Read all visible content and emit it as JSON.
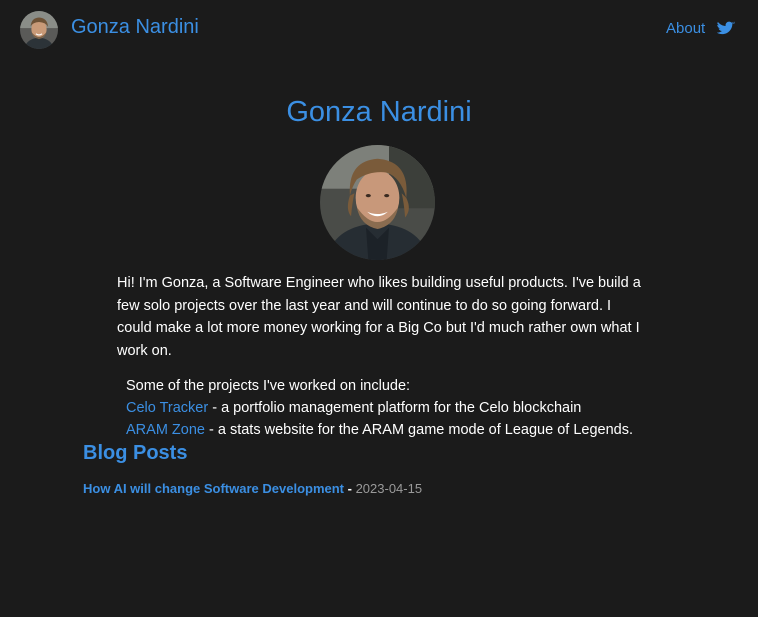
{
  "header": {
    "site_name": "Gonza Nardini",
    "nav_about": "About",
    "twitter_icon": "twitter-bird-icon"
  },
  "colors": {
    "background": "#1b1b1b",
    "accent": "#3b8fe3",
    "text": "#ffffff",
    "muted": "#9a9a9a"
  },
  "hero": {
    "title": "Gonza Nardini",
    "avatar_icon": "profile-photo"
  },
  "intro": "Hi! I'm Gonza, a Software Engineer who likes building useful products. I've build a few solo projects over the last year and will continue to do so going forward. I could make a lot more money working for a Big Co but I'd much rather own what I work on.",
  "projects": {
    "heading": "Some of the projects I've worked on include:",
    "items": [
      {
        "name": "Celo Tracker",
        "description": " - a portfolio management platform for the Celo blockchain"
      },
      {
        "name": "ARAM Zone",
        "description": " - a stats website for the ARAM game mode of League of Legends."
      }
    ]
  },
  "blog": {
    "heading": "Blog Posts",
    "posts": [
      {
        "title": "How AI will change Software Development",
        "separator": " - ",
        "date": "2023-04-15"
      }
    ]
  }
}
